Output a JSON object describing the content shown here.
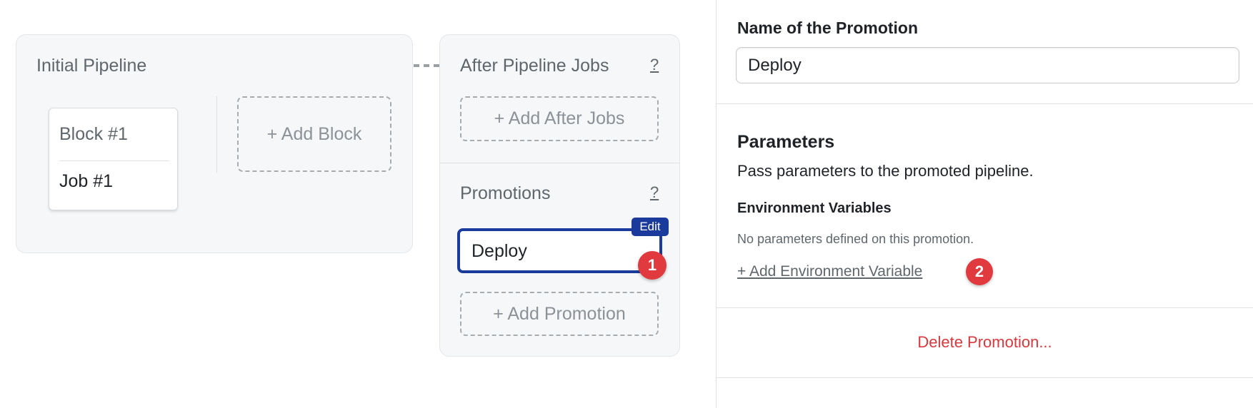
{
  "canvas": {
    "initial_pipeline": {
      "title": "Initial Pipeline",
      "blocks": [
        {
          "name": "Block #1",
          "jobs": [
            "Job #1"
          ]
        }
      ],
      "add_block_label": "+ Add Block"
    },
    "after_pipeline": {
      "title": "After Pipeline Jobs",
      "help": "?",
      "add_after_jobs_label": "+ Add After Jobs"
    },
    "promotions": {
      "title": "Promotions",
      "help": "?",
      "items": [
        {
          "name": "Deploy",
          "edit_label": "Edit",
          "selected": true
        }
      ],
      "add_promotion_label": "+ Add Promotion"
    },
    "annotation_1": "1"
  },
  "sidebar": {
    "name_label": "Name of the Promotion",
    "name_value": "Deploy",
    "parameters_title": "Parameters",
    "parameters_desc": "Pass parameters to the promoted pipeline.",
    "env_vars_title": "Environment Variables",
    "env_vars_empty": "No parameters defined on this promotion.",
    "add_env_var_label": "+ Add Environment Variable",
    "annotation_2": "2",
    "delete_label": "Delete Promotion..."
  },
  "colors": {
    "accent": "#1a3a9c",
    "danger": "#d6393e",
    "badge": "#e0393e"
  }
}
